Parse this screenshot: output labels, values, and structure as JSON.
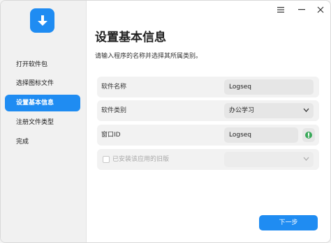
{
  "window_controls": {
    "menu_icon": "menu-icon",
    "minimize_icon": "minimize-icon",
    "close_icon": "close-icon"
  },
  "sidebar": {
    "app_icon": "download-icon",
    "items": [
      {
        "label": "打开软件包",
        "active": false
      },
      {
        "label": "选择图标文件",
        "active": false
      },
      {
        "label": "设置基本信息",
        "active": true
      },
      {
        "label": "注册文件类型",
        "active": false
      },
      {
        "label": "完成",
        "active": false
      }
    ]
  },
  "main": {
    "title": "设置基本信息",
    "subtitle": "请输入程序的名称并选择其所属类别。",
    "form": {
      "name_label": "软件名称",
      "name_value": "Logseq",
      "category_label": "软件类别",
      "category_value": "办公学习",
      "window_id_label": "窗口ID",
      "window_id_value": "Logseq",
      "pick_icon": "eyedropper-icon",
      "legacy_label": "已安装该应用的旧版",
      "legacy_checked": false
    },
    "next_label": "下一步"
  },
  "colors": {
    "accent": "#1f8cf2",
    "sidebar_bg": "#f1f1f1",
    "row_bg": "#f2f2f2"
  }
}
